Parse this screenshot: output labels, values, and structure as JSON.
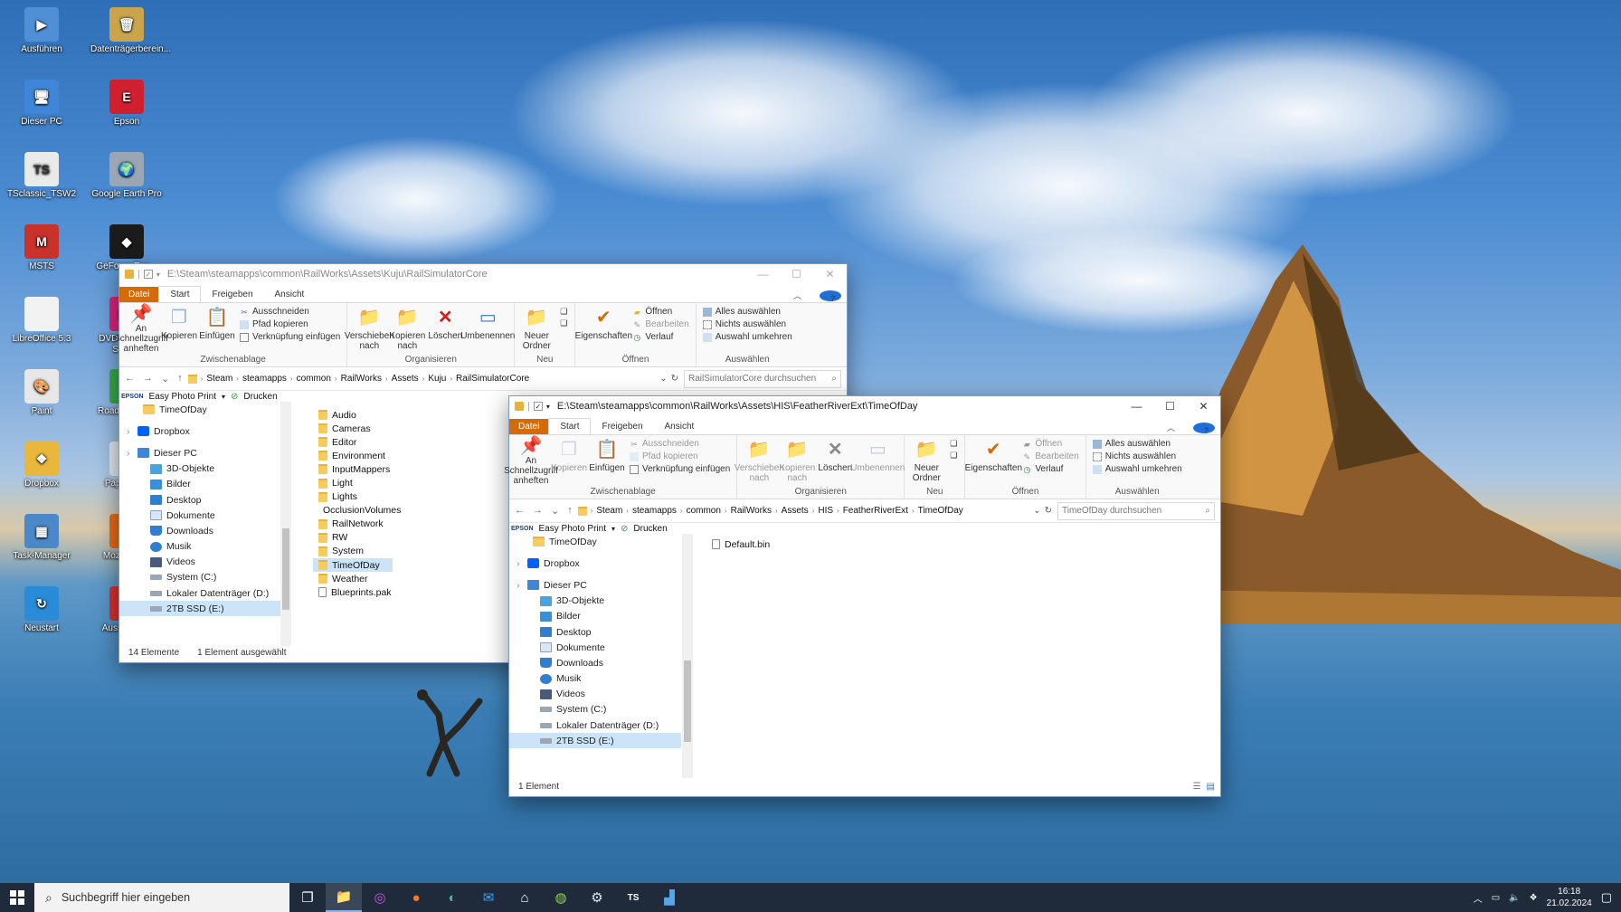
{
  "desktop": {
    "icons": [
      {
        "label": "Ausführen",
        "glyph": "▶",
        "bg": "#4f8fd6"
      },
      {
        "label": "Datenträgerberein...",
        "glyph": "🗑",
        "bg": "#c9a44a"
      },
      {
        "label": "Dieser PC",
        "glyph": "🖥",
        "bg": "#3f86d8"
      },
      {
        "label": "Epson",
        "glyph": "E",
        "bg": "#d02030"
      },
      {
        "label": "TSclassic_TSW2",
        "glyph": "TS",
        "bg": "#eaeaea"
      },
      {
        "label": "Google Earth Pro",
        "glyph": "🌍",
        "bg": "#9aa6b3"
      },
      {
        "label": "MSTS",
        "glyph": "M",
        "bg": "#c9312b"
      },
      {
        "label": "GeForce Exp...",
        "glyph": "◆",
        "bg": "#1b1b1b"
      },
      {
        "label": "LibreOffice 5.3",
        "glyph": "",
        "bg": "#f2f2f2"
      },
      {
        "label": "DVDVideoS... Studi...",
        "glyph": "FS",
        "bg": "#d9247a"
      },
      {
        "label": "Paint",
        "glyph": "🎨",
        "bg": "#e7e7e7"
      },
      {
        "label": "RoadeProps...",
        "glyph": "R",
        "bg": "#38a84a"
      },
      {
        "label": "Dropbox",
        "glyph": "❖",
        "bg": "#e8b73c"
      },
      {
        "label": "Papierkorb",
        "glyph": "♻",
        "bg": "#dfe8ef"
      },
      {
        "label": "Task-Manager",
        "glyph": "▦",
        "bg": "#4b88c9"
      },
      {
        "label": "MozBackup",
        "glyph": "◉",
        "bg": "#e86b1a"
      },
      {
        "label": "Neustart",
        "glyph": "↻",
        "bg": "#2a8bd8"
      },
      {
        "label": "Ausschalten",
        "glyph": "⏻",
        "bg": "#d63030"
      }
    ]
  },
  "window1": {
    "path": "E:\\Steam\\steamapps\\common\\RailWorks\\Assets\\Kuju\\RailSimulatorCore",
    "tabs": {
      "file": "Datei",
      "start": "Start",
      "share": "Freigeben",
      "view": "Ansicht"
    },
    "ribbon": {
      "pin": "An Schnellzugriff anheften",
      "copy": "Kopieren",
      "paste": "Einfügen",
      "cut": "Ausschneiden",
      "copypath": "Pfad kopieren",
      "pasteshortcut": "Verknüpfung einfügen",
      "clipboard": "Zwischenablage",
      "moveto": "Verschieben nach",
      "copyto": "Kopieren nach",
      "delete": "Löschen",
      "rename": "Umbenennen",
      "organize": "Organisieren",
      "newfolder": "Neuer Ordner",
      "new": "Neu",
      "properties": "Eigenschaften",
      "open": "Öffnen",
      "edit": "Bearbeiten",
      "history": "Verlauf",
      "opengroup": "Öffnen",
      "selectall": "Alles auswählen",
      "selectnone": "Nichts auswählen",
      "invert": "Auswahl umkehren",
      "select": "Auswählen"
    },
    "crumbs": [
      "Steam",
      "steamapps",
      "common",
      "RailWorks",
      "Assets",
      "Kuju",
      "RailSimulatorCore"
    ],
    "search": "RailSimulatorCore durchsuchen",
    "epson": {
      "brand": "EPSON",
      "app": "Easy Photo Print",
      "print": "Drucken"
    },
    "tree": [
      "TimeOfDay",
      "Dropbox",
      "Dieser PC",
      "3D-Objekte",
      "Bilder",
      "Desktop",
      "Dokumente",
      "Downloads",
      "Musik",
      "Videos",
      "System (C:)",
      "Lokaler Datenträger (D:)",
      "2TB SSD (E:)"
    ],
    "files": [
      "Audio",
      "Cameras",
      "Editor",
      "Environment",
      "InputMappers",
      "Light",
      "Lights",
      "OcclusionVolumes",
      "RailNetwork",
      "RW",
      "System",
      "TimeOfDay",
      "Weather",
      "Blueprints.pak"
    ],
    "status": {
      "count": "14 Elemente",
      "selected": "1 Element ausgewählt"
    }
  },
  "window2": {
    "path": "E:\\Steam\\steamapps\\common\\RailWorks\\Assets\\HIS\\FeatherRiverExt\\TimeOfDay",
    "crumbs": [
      "Steam",
      "steamapps",
      "common",
      "RailWorks",
      "Assets",
      "HIS",
      "FeatherRiverExt",
      "TimeOfDay"
    ],
    "search": "TimeOfDay durchsuchen",
    "tree": [
      "TimeOfDay",
      "Dropbox",
      "Dieser PC",
      "3D-Objekte",
      "Bilder",
      "Desktop",
      "Dokumente",
      "Downloads",
      "Musik",
      "Videos",
      "System (C:)",
      "Lokaler Datenträger (D:)",
      "2TB SSD (E:)"
    ],
    "files": [
      "Default.bin"
    ],
    "status": {
      "count": "1 Element"
    }
  },
  "taskbar": {
    "search_placeholder": "Suchbegriff hier eingeben",
    "time": "16:18",
    "date": "21.02.2024"
  }
}
